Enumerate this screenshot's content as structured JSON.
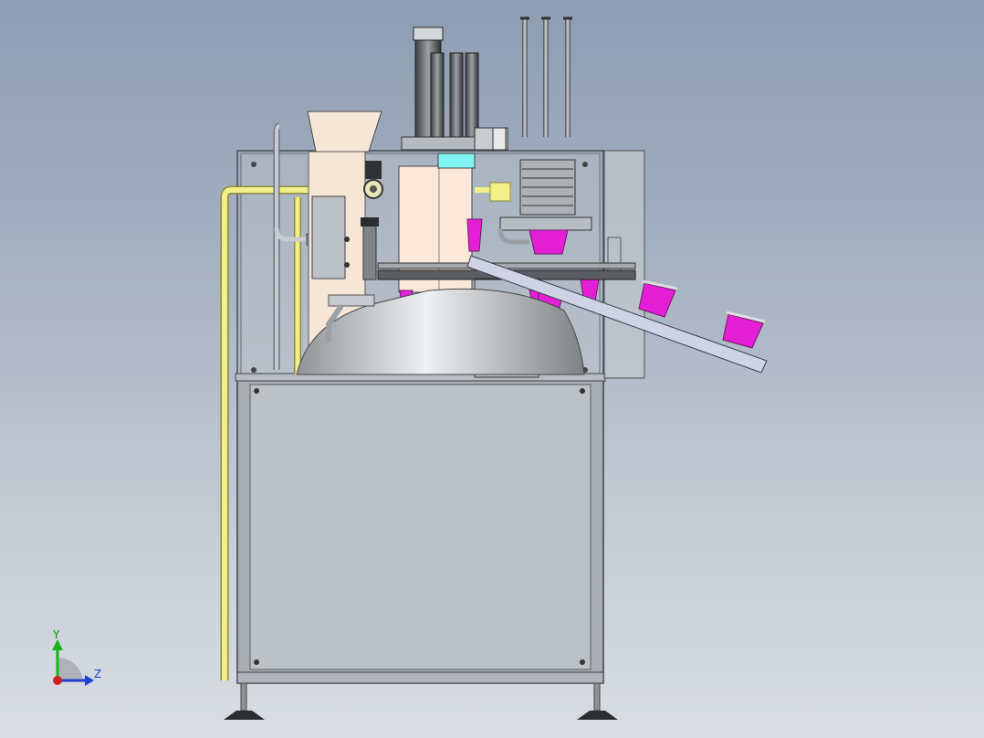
{
  "app": {
    "view": "cad-3d-viewport",
    "background": {
      "top": "#8e9db3",
      "bottom": "#d9dde3"
    }
  },
  "triad": {
    "y_label": "Y",
    "z_label": "Z",
    "y_color": "#19b319",
    "z_color": "#1f3fd0",
    "x_color": "#d01f1f"
  },
  "model": {
    "description_colors": {
      "frame": "#b7bcc1",
      "panel": "#b9bec2",
      "cups": "#e41fd6",
      "pipe_yellow": "#f3f08a",
      "hopper": "#f6e6d6",
      "dome": "#c7cacd",
      "highlight_cyan": "#7ff3ef"
    }
  }
}
